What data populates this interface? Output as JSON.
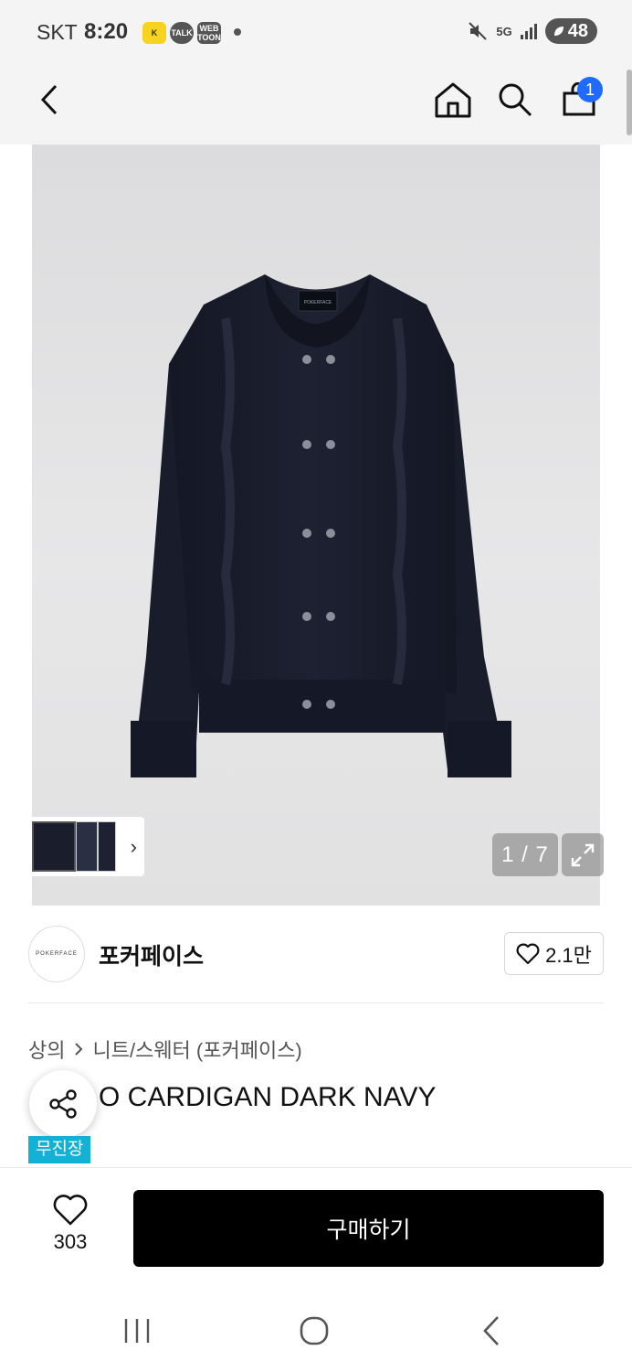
{
  "status_bar": {
    "carrier": "SKT",
    "time": "8:20",
    "apps": [
      "KakaoPage",
      "TALK",
      "WEB TOON"
    ],
    "network": "5G",
    "battery": "48"
  },
  "header": {
    "back_icon": "chevron-left-icon",
    "home_icon": "home-icon",
    "search_icon": "search-icon",
    "cart_icon": "shopping-bag-icon",
    "cart_count": "1"
  },
  "gallery": {
    "counter": "1 / 7",
    "brand_label_on_garment": "POKERFACE",
    "thumbnail_count": 3
  },
  "brand": {
    "logo_text": "POKERFACE",
    "name": "포커페이스",
    "likes": "2.1만"
  },
  "product": {
    "category": "상의",
    "subcategory": "니트/스웨터 (포커페이스)",
    "title": "O CARDIGAN DARK NAVY",
    "tag": "무진장"
  },
  "bottom_bar": {
    "wish_count": "303",
    "buy_label": "구매하기"
  },
  "colors": {
    "accent_badge": "#1f6bff",
    "tag": "#13b2d4",
    "buy_button": "#000000",
    "garment": "#1a1d2b"
  }
}
